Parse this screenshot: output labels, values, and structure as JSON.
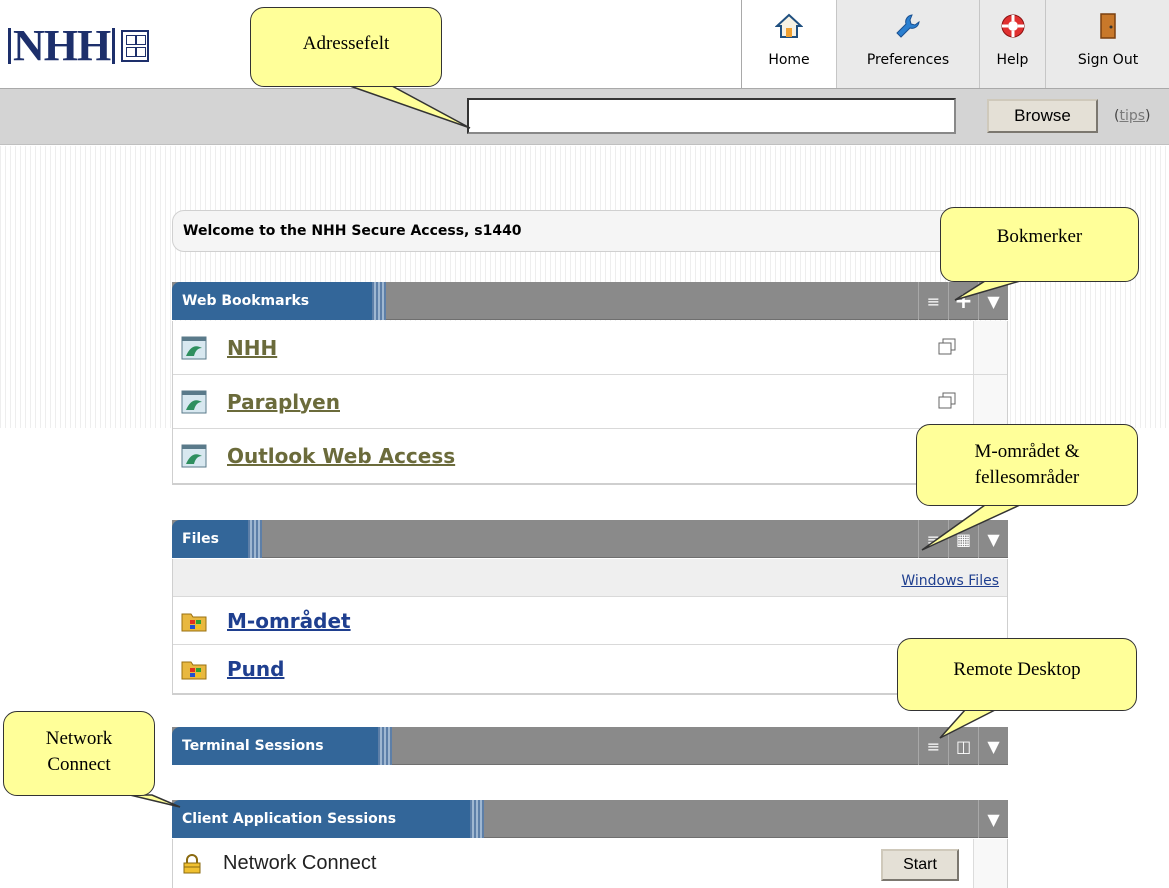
{
  "logo": {
    "text": "NHH"
  },
  "toolbar": {
    "home": "Home",
    "preferences": "Preferences",
    "help": "Help",
    "signout": "Sign Out"
  },
  "addressbar": {
    "url_value": "",
    "browse_label": "Browse",
    "tips_label": "tips"
  },
  "welcome": "Welcome to the NHH Secure Access, s1440",
  "web_bookmarks": {
    "title": "Web Bookmarks",
    "items": [
      {
        "label": "NHH"
      },
      {
        "label": "Paraplyen"
      },
      {
        "label": "Outlook Web Access"
      }
    ]
  },
  "files": {
    "title": "Files",
    "windows_files_link": "Windows Files",
    "items": [
      {
        "label": "M-området"
      },
      {
        "label": "Pund"
      }
    ]
  },
  "terminal_sessions": {
    "title": "Terminal Sessions"
  },
  "client_app_sessions": {
    "title": "Client Application Sessions",
    "items": [
      {
        "label": "Network Connect",
        "button": "Start"
      }
    ]
  },
  "callouts": {
    "adressefelt": "Adressefelt",
    "bokmerker": "Bokmerker",
    "m_omradet_line1": "M-området &",
    "m_omradet_line2": "fellesområder",
    "remote_desktop": "Remote Desktop",
    "network_connect_line1": "Network",
    "network_connect_line2": "Connect"
  },
  "colors": {
    "panel_title_bg": "#336699",
    "panel_header_bg": "#8a8a8a",
    "callout_fill": "#ffff99",
    "link_blue": "#1f3f8f",
    "bookmark_link": "#6b6b3b"
  }
}
